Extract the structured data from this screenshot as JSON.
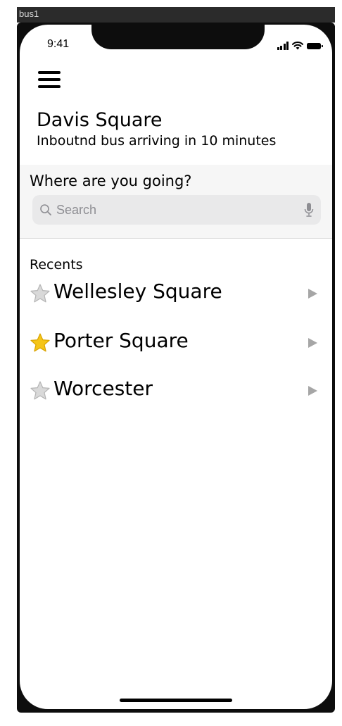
{
  "frame": {
    "label": "bus1"
  },
  "status_bar": {
    "time": "9:41"
  },
  "header": {
    "stop_name": "Davis Square",
    "arrival_text": "Inboutnd bus arriving in 10 minutes"
  },
  "search": {
    "heading": "Where are you going?",
    "placeholder": "Search",
    "value": ""
  },
  "recents": {
    "heading": "Recents",
    "items": [
      {
        "label": "Wellesley Square",
        "favorite": false,
        "star_icon": "star-outline-icon"
      },
      {
        "label": "Porter Square",
        "favorite": true,
        "star_icon": "star-filled-icon"
      },
      {
        "label": "Worcester",
        "favorite": false,
        "star_icon": "star-outline-icon"
      }
    ]
  },
  "colors": {
    "star_favorite": "#f5c518",
    "star_default": "#d9d9d9",
    "chevron": "#a6a6a6",
    "search_section_bg": "#f6f6f6",
    "search_bar_bg": "#e9e9ea"
  }
}
